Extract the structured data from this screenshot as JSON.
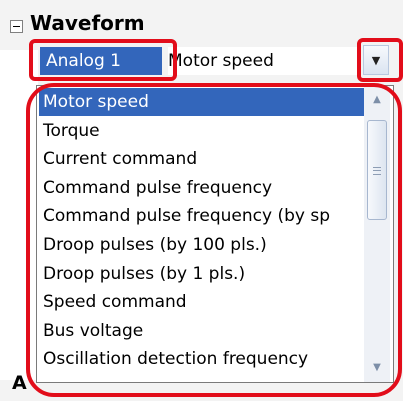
{
  "section": {
    "title": "Waveform",
    "expander_icon": "collapse-minus-icon",
    "next_section_initial": "A"
  },
  "selector": {
    "channel_label": "Analog 1",
    "selected_value": "Motor speed",
    "dropdown_icon": "chevron-down-icon"
  },
  "dropdown": {
    "items": [
      {
        "label": "Motor speed",
        "selected": true
      },
      {
        "label": "Torque",
        "selected": false
      },
      {
        "label": "Current command",
        "selected": false
      },
      {
        "label": "Command pulse frequency",
        "selected": false
      },
      {
        "label": "Command pulse frequency (by sp",
        "selected": false
      },
      {
        "label": "Droop pulses (by 100 pls.)",
        "selected": false
      },
      {
        "label": "Droop pulses (by 1 pls.)",
        "selected": false
      },
      {
        "label": "Speed command",
        "selected": false
      },
      {
        "label": "Bus voltage",
        "selected": false
      },
      {
        "label": "Oscillation detection frequency",
        "selected": false
      }
    ],
    "scroll_up_icon": "scroll-up-arrow-icon",
    "scroll_down_icon": "scroll-down-arrow-icon"
  },
  "colors": {
    "highlight": "#e20d1a",
    "selection": "#3366bb"
  }
}
